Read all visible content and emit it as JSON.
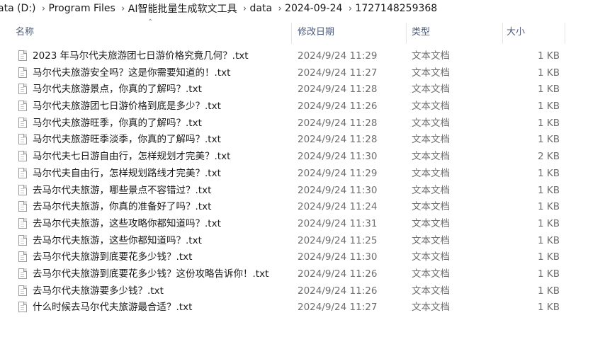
{
  "breadcrumb": [
    "ata (D:)",
    "Program Files",
    "AI智能批量生成软文工具",
    "data",
    "2024-09-24",
    "1727148259368"
  ],
  "columns": {
    "name": "名称",
    "date": "修改日期",
    "type": "类型",
    "size": "大小"
  },
  "files": [
    {
      "name": "2023 年马尔代夫旅游团七日游价格究竟几何？.txt",
      "date": "2024/9/24 11:29",
      "type": "文本文档",
      "size": "1 KB"
    },
    {
      "name": "马尔代夫旅游安全吗？这是你需要知道的！.txt",
      "date": "2024/9/24 11:27",
      "type": "文本文档",
      "size": "1 KB"
    },
    {
      "name": "马尔代夫旅游景点，你真的了解吗？.txt",
      "date": "2024/9/24 11:28",
      "type": "文本文档",
      "size": "1 KB"
    },
    {
      "name": "马尔代夫旅游团七日游价格到底是多少？.txt",
      "date": "2024/9/24 11:26",
      "type": "文本文档",
      "size": "1 KB"
    },
    {
      "name": "马尔代夫旅游旺季，你真的了解吗？.txt",
      "date": "2024/9/24 11:28",
      "type": "文本文档",
      "size": "1 KB"
    },
    {
      "name": "马尔代夫旅游旺季淡季，你真的了解吗？.txt",
      "date": "2024/9/24 11:28",
      "type": "文本文档",
      "size": "1 KB"
    },
    {
      "name": "马尔代夫七日游自由行，怎样规划才完美？.txt",
      "date": "2024/9/24 11:30",
      "type": "文本文档",
      "size": "2 KB"
    },
    {
      "name": "马尔代夫自由行，怎样规划路线才完美？.txt",
      "date": "2024/9/24 11:29",
      "type": "文本文档",
      "size": "1 KB"
    },
    {
      "name": "去马尔代夫旅游，哪些景点不容错过？.txt",
      "date": "2024/9/24 11:30",
      "type": "文本文档",
      "size": "1 KB"
    },
    {
      "name": "去马尔代夫旅游，你真的准备好了吗？.txt",
      "date": "2024/9/24 11:24",
      "type": "文本文档",
      "size": "1 KB"
    },
    {
      "name": "去马尔代夫旅游，这些攻略你都知道吗？.txt",
      "date": "2024/9/24 11:31",
      "type": "文本文档",
      "size": "1 KB"
    },
    {
      "name": "去马尔代夫旅游，这些你都知道吗？.txt",
      "date": "2024/9/24 11:25",
      "type": "文本文档",
      "size": "1 KB"
    },
    {
      "name": "去马尔代夫旅游到底要花多少钱？.txt",
      "date": "2024/9/24 11:30",
      "type": "文本文档",
      "size": "1 KB"
    },
    {
      "name": "去马尔代夫旅游到底要花多少钱？这份攻略告诉你！.txt",
      "date": "2024/9/24 11:26",
      "type": "文本文档",
      "size": "1 KB"
    },
    {
      "name": "去马尔代夫旅游要多少钱？.txt",
      "date": "2024/9/24 11:26",
      "type": "文本文档",
      "size": "1 KB"
    },
    {
      "name": "什么时候去马尔代夫旅游最合适？.txt",
      "date": "2024/9/24 11:27",
      "type": "文本文档",
      "size": "1 KB"
    }
  ]
}
